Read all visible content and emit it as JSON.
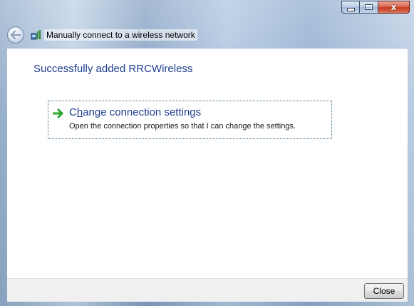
{
  "window": {
    "title": "Manually connect to a wireless network",
    "controls": {
      "minimize_icon": "minimize-icon",
      "maximize_icon": "maximize-icon",
      "close_glyph": "x"
    }
  },
  "nav": {
    "back_icon": "back-arrow-icon",
    "network_icon": "wireless-network-icon"
  },
  "main": {
    "heading": "Successfully added RRCWireless",
    "option": {
      "icon": "green-arrow-icon",
      "title_first": "C",
      "title_underlined": "h",
      "title_rest": "ange connection settings",
      "description": "Open the connection properties so that I can change the settings."
    }
  },
  "footer": {
    "close_label": "Close"
  },
  "colors": {
    "heading": "#1e3d8f",
    "link": "#1e3d8f",
    "arrow": "#2ea52e",
    "footer_bg": "#f0f0f0"
  }
}
